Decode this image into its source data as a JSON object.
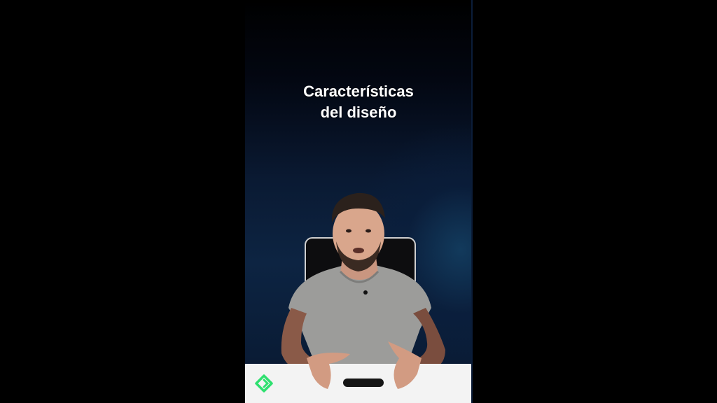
{
  "caption": {
    "line1": "Características",
    "line2": "del diseño"
  },
  "logo": {
    "icon": "green-brand-logo-icon",
    "color": "#2ee06f"
  },
  "colors": {
    "background": "#000000",
    "shirt": "#9c9c9a",
    "desk": "#f3f3f3"
  }
}
